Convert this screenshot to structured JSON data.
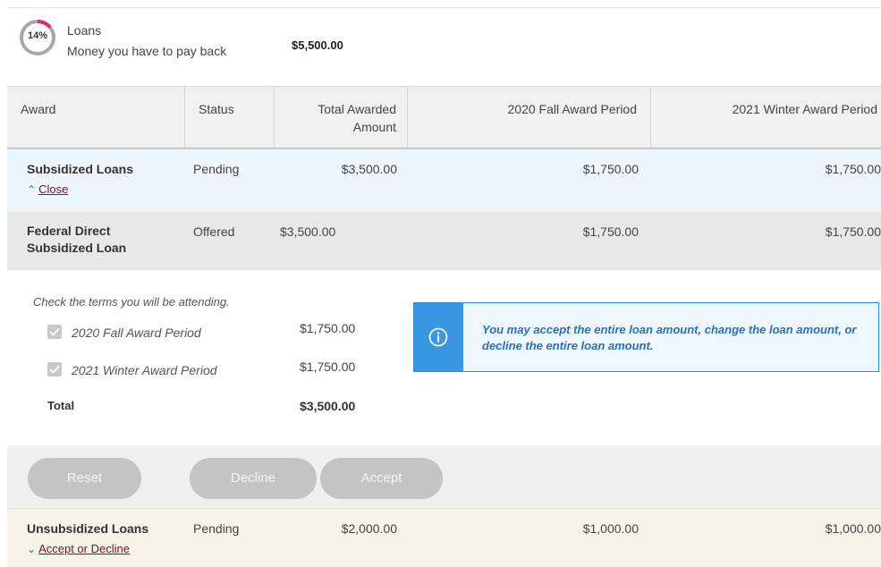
{
  "summary": {
    "percent": "14%",
    "percent_value": 14,
    "title": "Loans",
    "subtitle": "Money you have to pay back",
    "amount": "$5,500.00",
    "accent_color": "#d6336c",
    "track_color": "#9e9e9e"
  },
  "table": {
    "headers": {
      "award": "Award",
      "status": "Status",
      "total_line1": "Total Awarded",
      "total_line2": "Amount",
      "fall": "2020 Fall Award Period",
      "winter": "2021 Winter Award Period"
    }
  },
  "subsidized": {
    "name": "Subsidized Loans",
    "status": "Pending",
    "total": "$3,500.00",
    "fall": "$1,750.00",
    "winter": "$1,750.00",
    "toggle_label": "Close"
  },
  "federal": {
    "name_line1": "Federal Direct",
    "name_line2": "Subsidized Loan",
    "status": "Offered",
    "total": "$3,500.00",
    "fall": "$1,750.00",
    "winter": "$1,750.00"
  },
  "detail": {
    "instruction": "Check the terms you will be attending.",
    "terms": [
      {
        "label": "2020 Fall Award Period",
        "amount": "$1,750.00",
        "checked": true
      },
      {
        "label": "2021 Winter Award Period",
        "amount": "$1,750.00",
        "checked": true
      }
    ],
    "total_label": "Total",
    "total_amount": "$3,500.00",
    "info_text": "You may accept the entire loan amount, change the loan amount, or decline the entire loan amount."
  },
  "buttons": {
    "reset": "Reset",
    "decline": "Decline",
    "accept": "Accept"
  },
  "unsubsidized": {
    "name": "Unsubsidized Loans",
    "status": "Pending",
    "total": "$2,000.00",
    "fall": "$1,000.00",
    "winter": "$1,000.00",
    "toggle_label": "Accept or Decline"
  }
}
